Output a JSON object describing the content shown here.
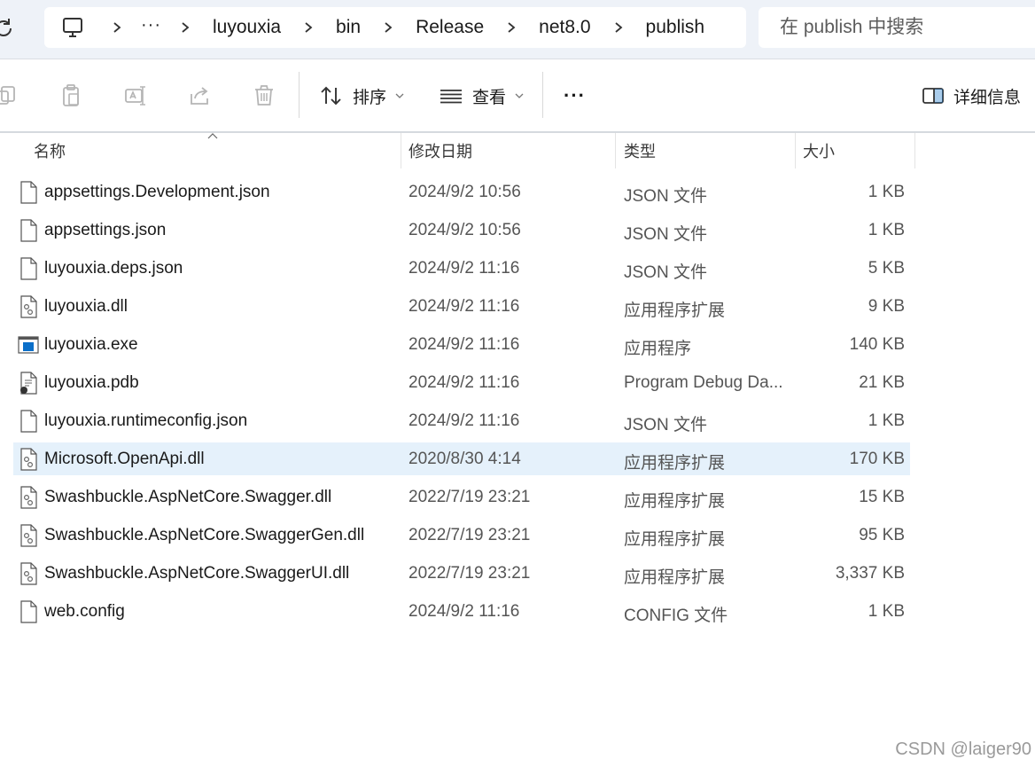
{
  "address": {
    "overflow_label": "···",
    "crumbs": [
      "luyouxia",
      "bin",
      "Release",
      "net8.0",
      "publish"
    ]
  },
  "search": {
    "placeholder": "在 publish 中搜索"
  },
  "toolbar": {
    "sort_label": "排序",
    "view_label": "查看",
    "more_label": "···",
    "details_label": "详细信息"
  },
  "columns": {
    "name": "名称",
    "date": "修改日期",
    "type": "类型",
    "size": "大小"
  },
  "files": [
    {
      "name": "appsettings.Development.json",
      "date": "2024/9/2 10:56",
      "type": "JSON 文件",
      "size": "1 KB",
      "icon": "file-icon"
    },
    {
      "name": "appsettings.json",
      "date": "2024/9/2 10:56",
      "type": "JSON 文件",
      "size": "1 KB",
      "icon": "file-icon"
    },
    {
      "name": "luyouxia.deps.json",
      "date": "2024/9/2 11:16",
      "type": "JSON 文件",
      "size": "5 KB",
      "icon": "file-icon"
    },
    {
      "name": "luyouxia.dll",
      "date": "2024/9/2 11:16",
      "type": "应用程序扩展",
      "size": "9 KB",
      "icon": "dll-icon"
    },
    {
      "name": "luyouxia.exe",
      "date": "2024/9/2 11:16",
      "type": "应用程序",
      "size": "140 KB",
      "icon": "exe-icon"
    },
    {
      "name": "luyouxia.pdb",
      "date": "2024/9/2 11:16",
      "type": "Program Debug Da...",
      "size": "21 KB",
      "icon": "pdb-icon"
    },
    {
      "name": "luyouxia.runtimeconfig.json",
      "date": "2024/9/2 11:16",
      "type": "JSON 文件",
      "size": "1 KB",
      "icon": "file-icon"
    },
    {
      "name": "Microsoft.OpenApi.dll",
      "date": "2020/8/30 4:14",
      "type": "应用程序扩展",
      "size": "170 KB",
      "icon": "dll-icon",
      "selected": true
    },
    {
      "name": "Swashbuckle.AspNetCore.Swagger.dll",
      "date": "2022/7/19 23:21",
      "type": "应用程序扩展",
      "size": "15 KB",
      "icon": "dll-icon"
    },
    {
      "name": "Swashbuckle.AspNetCore.SwaggerGen.dll",
      "date": "2022/7/19 23:21",
      "type": "应用程序扩展",
      "size": "95 KB",
      "icon": "dll-icon"
    },
    {
      "name": "Swashbuckle.AspNetCore.SwaggerUI.dll",
      "date": "2022/7/19 23:21",
      "type": "应用程序扩展",
      "size": "3,337 KB",
      "icon": "dll-icon"
    },
    {
      "name": "web.config",
      "date": "2024/9/2 11:16",
      "type": "CONFIG 文件",
      "size": "1 KB",
      "icon": "file-icon"
    }
  ],
  "watermark": "CSDN @laiger90",
  "colors": {
    "topbar_bg": "#eef2f8",
    "selected_row": "#e5f1fb",
    "exe_accent": "#0b6fc9"
  }
}
